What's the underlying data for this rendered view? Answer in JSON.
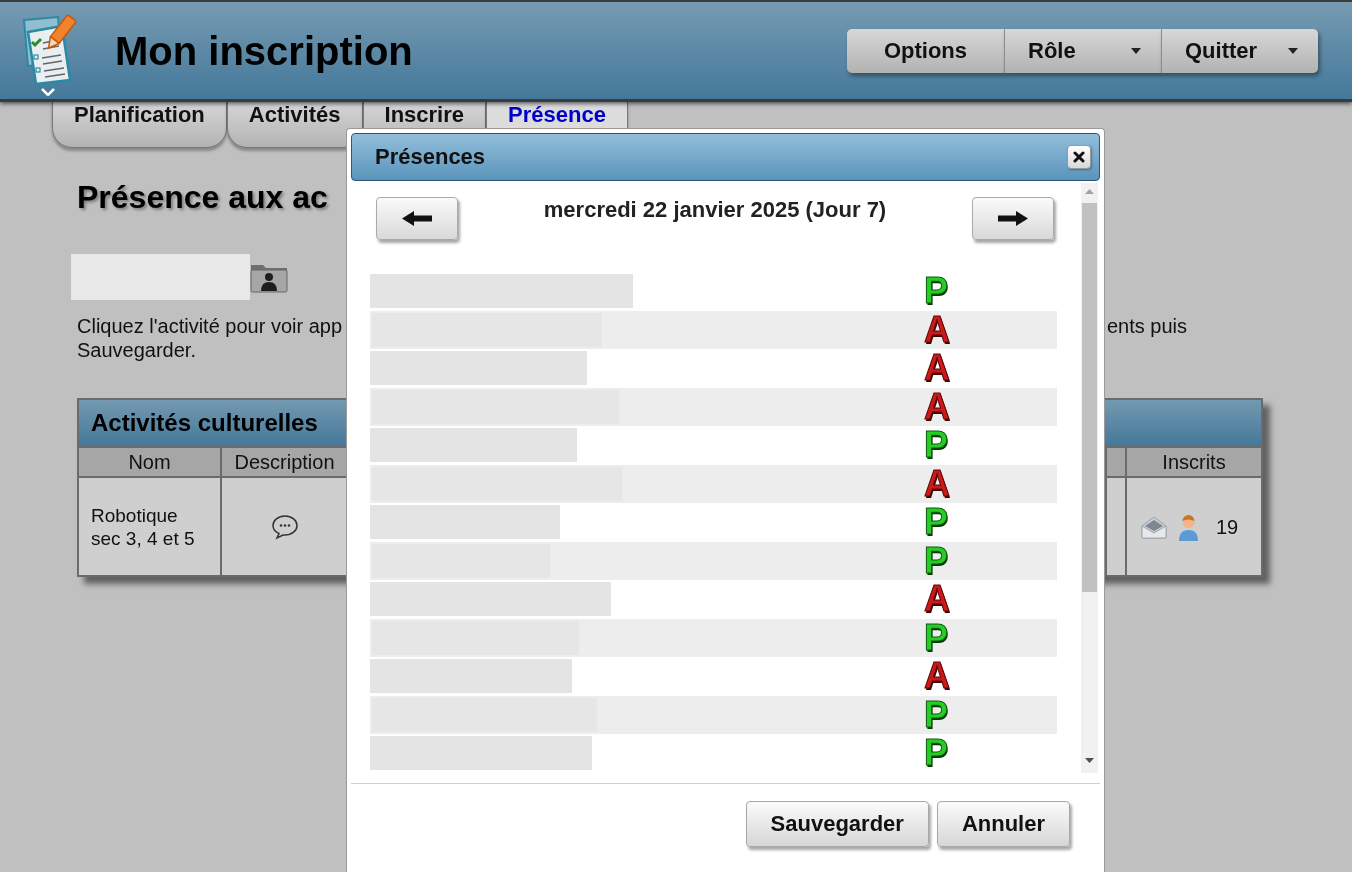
{
  "header": {
    "title": "Mon inscription",
    "menu_buttons": [
      {
        "label": "Options",
        "dropdown": false
      },
      {
        "label": "Rôle",
        "dropdown": true
      },
      {
        "label": "Quitter",
        "dropdown": true
      }
    ]
  },
  "tabs": [
    {
      "label": "Planification",
      "selected": false
    },
    {
      "label": "Activités",
      "selected": false
    },
    {
      "label": "Inscrire",
      "selected": false
    },
    {
      "label": "Présence",
      "selected": true
    }
  ],
  "page": {
    "heading": "Présence aux ac",
    "instructions": {
      "line_1_start": "Cliquez l'activité pour voir app",
      "line_1_end": "ents puis",
      "line_2": "Sauvegarder."
    }
  },
  "table": {
    "title": "Activités culturelles",
    "columns": [
      "Nom",
      "Description",
      "Inscrits"
    ],
    "rows": [
      {
        "nom": "Robotique\nsec 3, 4 et 5",
        "inscrits": "19"
      }
    ]
  },
  "dialog": {
    "title": "Présences",
    "date": "mercredi 22 janvier 2025 (Jour 7)",
    "students": [
      {
        "mark": "P",
        "present": true
      },
      {
        "mark": "A",
        "present": false
      },
      {
        "mark": "A",
        "present": false
      },
      {
        "mark": "A",
        "present": false
      },
      {
        "mark": "P",
        "present": true
      },
      {
        "mark": "A",
        "present": false
      },
      {
        "mark": "P",
        "present": true
      },
      {
        "mark": "P",
        "present": true
      },
      {
        "mark": "A",
        "present": false
      },
      {
        "mark": "P",
        "present": true
      },
      {
        "mark": "A",
        "present": false
      },
      {
        "mark": "P",
        "present": true
      },
      {
        "mark": "P",
        "present": true
      }
    ],
    "buttons": [
      "Sauvegarder",
      "Annuler"
    ]
  }
}
